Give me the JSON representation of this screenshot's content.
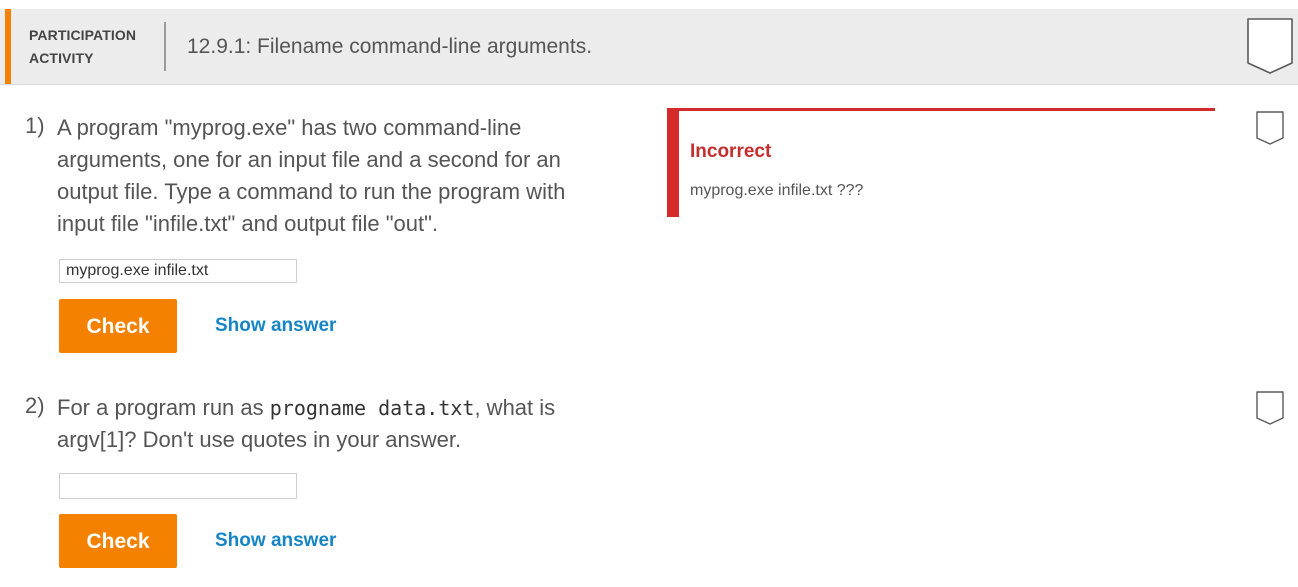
{
  "header": {
    "activity_type_line1": "PARTICIPATION",
    "activity_type_line2": "ACTIVITY",
    "title": "12.9.1: Filename command-line arguments."
  },
  "questions": [
    {
      "number": "1)",
      "text": "A program \"myprog.exe\" has two command-line arguments, one for an input file and a second for an output file. Type a command to run the program with input file \"infile.txt\" and output file \"out\".",
      "input_value": "myprog.exe infile.txt",
      "check_label": "Check",
      "show_answer_label": "Show answer",
      "feedback": {
        "title": "Incorrect",
        "text": "myprog.exe infile.txt ???"
      }
    },
    {
      "number": "2)",
      "text_before": "For a program run as ",
      "code": "progname data.txt",
      "text_after": ", what is argv[1]? Don't use quotes in your answer.",
      "input_value": "",
      "check_label": "Check",
      "show_answer_label": "Show answer"
    }
  ],
  "colors": {
    "accent_orange": "#f48200",
    "incorrect_red": "#d42a2a",
    "link_blue": "#1685c5",
    "header_bg": "#ececec"
  },
  "icons": {
    "activity_completion": "completion-shield-icon",
    "question_completion": "question-completion-shield-icon"
  }
}
